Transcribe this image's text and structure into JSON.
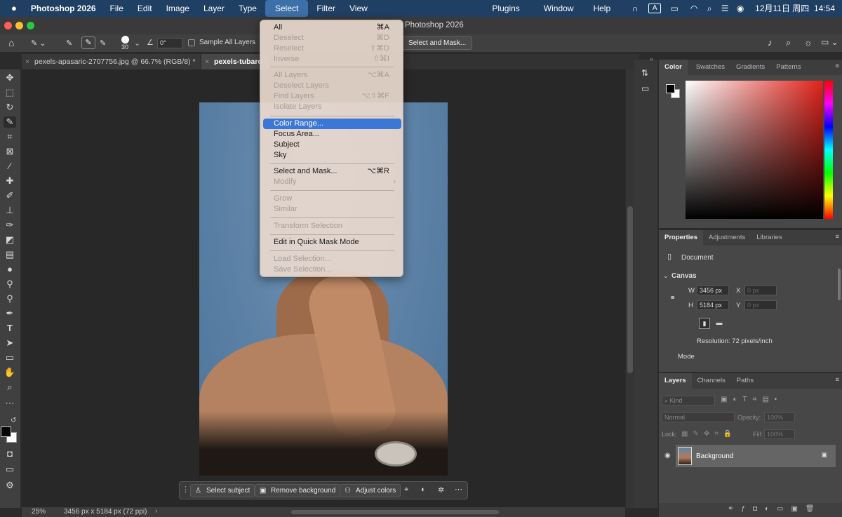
{
  "menubar": {
    "apple": "",
    "app_name": "Photoshop 2026",
    "items": [
      "File",
      "Edit",
      "Image",
      "Layer",
      "Type",
      "Select",
      "Filter",
      "View"
    ],
    "active": "Select",
    "right_items": [
      "Plugins",
      "Window",
      "Help"
    ],
    "input_indicator": "A",
    "datetime": "12月11日 周四  14:54"
  },
  "window_title": "Photoshop 2026",
  "options_bar": {
    "brush_size": "30",
    "angle": "0°",
    "sample_all_layers": "Sample All Layers",
    "select_and_mask": "Select and Mask..."
  },
  "doc_tabs": [
    {
      "label": "pexels-apasaric-2707756.jpg @ 66.7% (RGB/8) *"
    },
    {
      "label": "pexels-tubarc"
    }
  ],
  "select_menu": {
    "items": [
      {
        "label": "All",
        "shortcut": "⌘A",
        "enabled": true
      },
      {
        "label": "Deselect",
        "shortcut": "⌘D",
        "enabled": false
      },
      {
        "label": "Reselect",
        "shortcut": "⇧⌘D",
        "enabled": false
      },
      {
        "label": "Inverse",
        "shortcut": "⇧⌘I",
        "enabled": false
      },
      {
        "label": "All Layers",
        "shortcut": "⌥⌘A",
        "enabled": false
      },
      {
        "label": "Deselect Layers",
        "shortcut": "",
        "enabled": false
      },
      {
        "label": "Find Layers",
        "shortcut": "⌥⇧⌘F",
        "enabled": false
      },
      {
        "label": "Isolate Layers",
        "shortcut": "",
        "enabled": false
      },
      {
        "label": "Color Range...",
        "shortcut": "",
        "enabled": true,
        "highlighted": true
      },
      {
        "label": "Focus Area...",
        "shortcut": "",
        "enabled": true
      },
      {
        "label": "Subject",
        "shortcut": "",
        "enabled": true
      },
      {
        "label": "Sky",
        "shortcut": "",
        "enabled": true
      },
      {
        "label": "Select and Mask...",
        "shortcut": "⌥⌘R",
        "enabled": true
      },
      {
        "label": "Modify",
        "shortcut": "›",
        "enabled": false
      },
      {
        "label": "Grow",
        "shortcut": "",
        "enabled": false
      },
      {
        "label": "Similar",
        "shortcut": "",
        "enabled": false
      },
      {
        "label": "Transform Selection",
        "shortcut": "",
        "enabled": false
      },
      {
        "label": "Edit in Quick Mask Mode",
        "shortcut": "",
        "enabled": true
      },
      {
        "label": "Load Selection...",
        "shortcut": "",
        "enabled": false
      },
      {
        "label": "Save Selection...",
        "shortcut": "",
        "enabled": false
      }
    ]
  },
  "color_panel": {
    "tabs": [
      "Color",
      "Swatches",
      "Gradients",
      "Patterns"
    ],
    "active": "Color",
    "hue_color": "#e0221a"
  },
  "properties_panel": {
    "tabs": [
      "Properties",
      "Adjustments",
      "Libraries"
    ],
    "active": "Properties",
    "doc_label": "Document",
    "section": "Canvas",
    "w_label": "W",
    "w_value": "3456 px",
    "h_label": "H",
    "h_value": "5184 px",
    "x_label": "X",
    "x_value": "0 px",
    "y_label": "Y",
    "y_value": "0 px",
    "resolution": "Resolution: 72 pixels/inch",
    "mode": "Mode"
  },
  "layers_panel": {
    "tabs": [
      "Layers",
      "Channels",
      "Paths"
    ],
    "active": "Layers",
    "filter": "Kind",
    "blend_mode": "Normal",
    "opacity_label": "Opacity:",
    "opacity_value": "100%",
    "lock_label": "Lock:",
    "fill_label": "Fill:",
    "fill_value": "100%",
    "layer_name": "Background"
  },
  "context_bar": {
    "select_subject": "Select subject",
    "remove_background": "Remove background",
    "adjust_colors": "Adjust colors"
  },
  "status": {
    "zoom": "25%",
    "doc_info": "3456 px x 5184 px (72 ppi)"
  }
}
